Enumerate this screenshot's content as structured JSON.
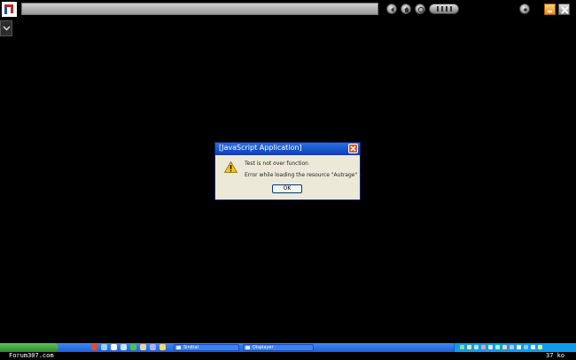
{
  "dialog": {
    "title": "[JavaScript Application]",
    "line1": "Test is not over function",
    "line2": "Error while loading the resource \"Autrage\" 1",
    "ok_label": "OK"
  },
  "taskbar": {
    "tasks": [
      {
        "label": "Sinitial"
      },
      {
        "label": "Displayer"
      }
    ]
  },
  "footer": {
    "site": "Forum307.com",
    "size": "37 ko"
  },
  "colors": {
    "titlebar": "#0b3eb8",
    "dialog_bg": "#ece9d8",
    "taskbar": "#2a6ee6",
    "tray": "#0f9cf0",
    "start": "#3fa83b"
  },
  "icons": {
    "warning": "warning-icon",
    "close": "close-icon",
    "dropdown": "chevron-down-icon"
  }
}
